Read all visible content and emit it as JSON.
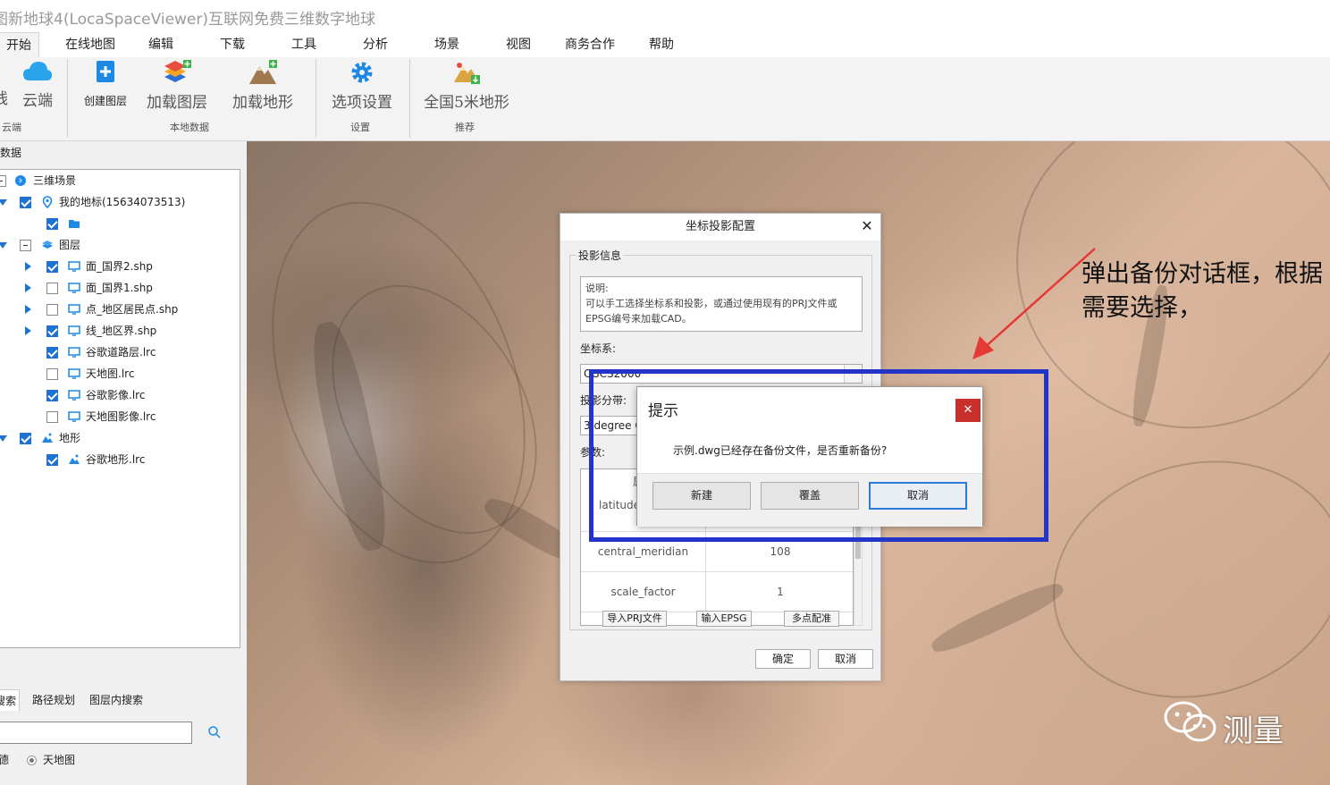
{
  "window": {
    "title": "图新地球4(LocaSpaceViewer)互联网免费三维数字地球"
  },
  "tabs": [
    {
      "label": "开始",
      "active": true
    },
    {
      "label": "在线地图"
    },
    {
      "label": "编辑"
    },
    {
      "label": "下载"
    },
    {
      "label": "工具"
    },
    {
      "label": "分析"
    },
    {
      "label": "场景"
    },
    {
      "label": "视图"
    },
    {
      "label": "商务合作"
    },
    {
      "label": "帮助"
    }
  ],
  "ribbon": {
    "cloud_label": "云端",
    "cloud_group": "云端",
    "create_layer_label": "创建图层",
    "load_layer_label": "加载图层",
    "load_terrain_label": "加载地形",
    "local_data_group": "本地数据",
    "options_label": "选项设置",
    "settings_group": "设置",
    "national_terrain_label": "全国5米地形",
    "recommend_group": "推荐"
  },
  "left_panel": {
    "header": "数据",
    "tree": [
      {
        "label": "三维场景"
      },
      {
        "label": "我的地标(15634073513)"
      },
      {
        "label": ""
      },
      {
        "label": "图层"
      },
      {
        "label": "面_国界2.shp"
      },
      {
        "label": "面_国界1.shp"
      },
      {
        "label": "点_地区居民点.shp"
      },
      {
        "label": "线_地区界.shp"
      },
      {
        "label": "谷歌道路层.lrc"
      },
      {
        "label": "天地图.lrc"
      },
      {
        "label": "谷歌影像.lrc"
      },
      {
        "label": "天地图影像.lrc"
      },
      {
        "label": "地形"
      },
      {
        "label": "谷歌地形.lrc"
      }
    ],
    "search_tabs": [
      "搜索",
      "路径规划",
      "图层内搜索"
    ],
    "search_placeholder": "",
    "radio_options": [
      "德",
      "天地图"
    ]
  },
  "projection_dialog": {
    "title": "坐标投影配置",
    "section_label": "投影信息",
    "description_label": "说明:",
    "description_text": "可以手工选择坐标系和投影，或通过使用现有的PRJ文件或EPSG编号来加载CAD。",
    "coord_system_label": "坐标系:",
    "coord_system_value": "CGCS2000",
    "zone_label": "投影分带:",
    "zone_value": "3 degree G",
    "params_label": "参数:",
    "params": [
      {
        "name": "latitude_",
        "value": ""
      },
      {
        "name": "central_meridian",
        "value": "108"
      },
      {
        "name": "scale_factor",
        "value": "1"
      }
    ],
    "params_header_partial": "属",
    "import_prj_label": "导入PRJ文件",
    "input_epsg_label": "输入EPSG",
    "multipoint_label": "多点配准",
    "ok_label": "确定",
    "cancel_label": "取消"
  },
  "prompt_dialog": {
    "title": "提示",
    "message": "示例.dwg已经存在备份文件，是否重新备份?",
    "new_label": "新建",
    "overwrite_label": "覆盖",
    "cancel_label": "取消"
  },
  "annotation": {
    "text": "弹出备份对话框，根据需要选择，"
  },
  "watermark": {
    "text": "测量"
  }
}
